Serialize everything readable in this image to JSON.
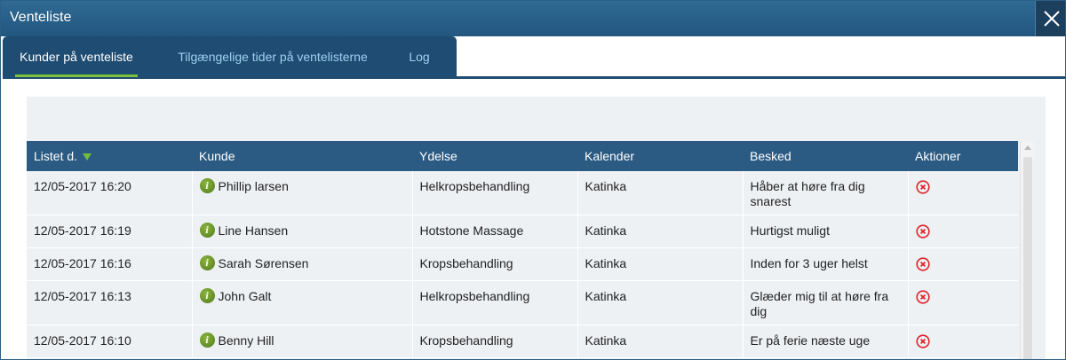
{
  "window": {
    "title": "Venteliste"
  },
  "tabs": [
    {
      "label": "Kunder på venteliste",
      "active": true
    },
    {
      "label": "Tilgængelige tider på ventelisterne",
      "active": false
    },
    {
      "label": "Log",
      "active": false
    }
  ],
  "colors": {
    "titlebar": "#22577f",
    "tab_bg": "#1e4c72",
    "tab_active_underline": "#7dbf3f",
    "header_bg": "#2b5b82",
    "row_bg": "#eef1f4",
    "delete_icon": "#e0202a",
    "info_icon": "#5e8a24"
  },
  "table": {
    "sort_indicator": "sort-descending-icon",
    "columns": [
      "Listet d.",
      "Kunde",
      "Ydelse",
      "Kalender",
      "Besked",
      "Aktioner"
    ],
    "rows": [
      {
        "listed": "12/05-2017 16:20",
        "customer": "Phillip larsen",
        "service": "Helkropsbehandling",
        "calendar": "Katinka",
        "message": "Håber at høre fra dig snarest",
        "action_icon": "delete-icon"
      },
      {
        "listed": "12/05-2017 16:19",
        "customer": "Line Hansen",
        "service": "Hotstone Massage",
        "calendar": "Katinka",
        "message": "Hurtigst muligt",
        "action_icon": "delete-icon"
      },
      {
        "listed": "12/05-2017 16:16",
        "customer": "Sarah Sørensen",
        "service": "Kropsbehandling",
        "calendar": "Katinka",
        "message": "Inden for 3 uger helst",
        "action_icon": "delete-icon"
      },
      {
        "listed": "12/05-2017 16:13",
        "customer": "John Galt",
        "service": "Helkropsbehandling",
        "calendar": "Katinka",
        "message": "Glæder mig til at høre fra dig",
        "action_icon": "delete-icon"
      },
      {
        "listed": "12/05-2017 16:10",
        "customer": "Benny Hill",
        "service": "Kropsbehandling",
        "calendar": "Katinka",
        "message": "Er på ferie næste uge",
        "action_icon": "delete-icon"
      }
    ]
  }
}
